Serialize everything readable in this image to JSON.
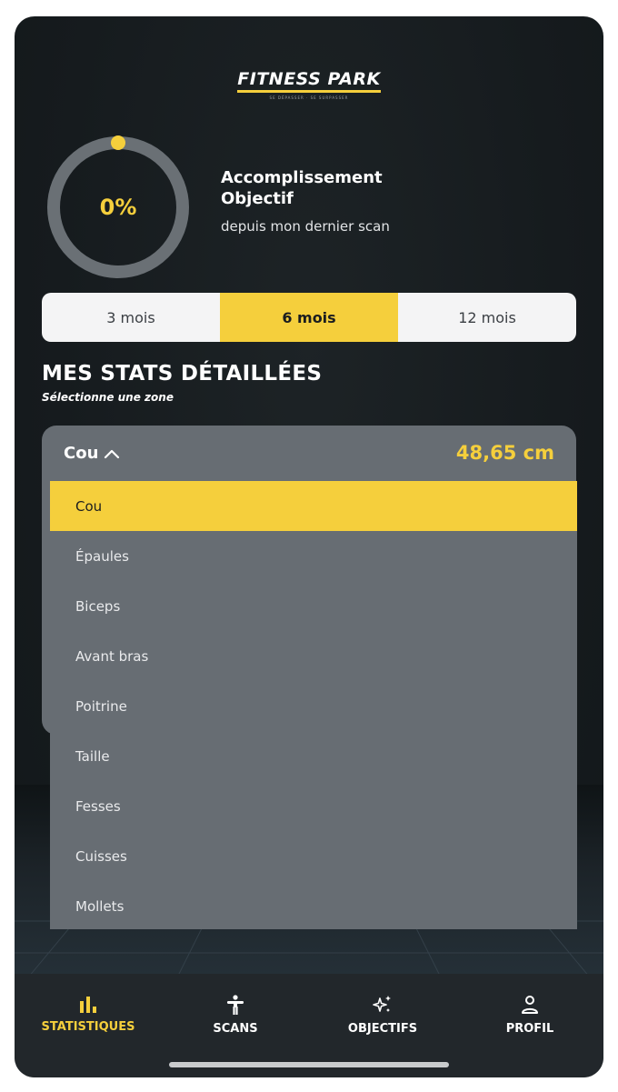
{
  "header": {
    "logo_text": "FITNESS PARK",
    "logo_tagline": "SE DÉPASSER · SE SURPASSER"
  },
  "progress": {
    "percent_label": "0%",
    "percent_value": 0,
    "title": "Accomplissement Objectif",
    "subtitle": "depuis mon dernier scan"
  },
  "period": {
    "options": [
      "3 mois",
      "6 mois",
      "12 mois"
    ],
    "selected": "6 mois"
  },
  "stats": {
    "title": "MES STATS DÉTAILLÉES",
    "subtitle": "Sélectionne une zone",
    "selected_zone": "Cou",
    "value": "48,65 cm",
    "zones": [
      "Cou",
      "Épaules",
      "Biceps",
      "Avant bras",
      "Poitrine",
      "Taille",
      "Fesses",
      "Cuisses",
      "Mollets"
    ]
  },
  "nav": {
    "tabs": [
      {
        "label": "STATISTIQUES",
        "icon": "bar-chart-icon",
        "active": true
      },
      {
        "label": "SCANS",
        "icon": "body-icon",
        "active": false
      },
      {
        "label": "OBJECTIFS",
        "icon": "sparkles-icon",
        "active": false
      },
      {
        "label": "PROFIL",
        "icon": "user-icon",
        "active": false
      }
    ]
  },
  "colors": {
    "accent": "#f5cf3c",
    "background": "#161b1e",
    "card": "#676d73",
    "tabbar": "#22272b"
  }
}
